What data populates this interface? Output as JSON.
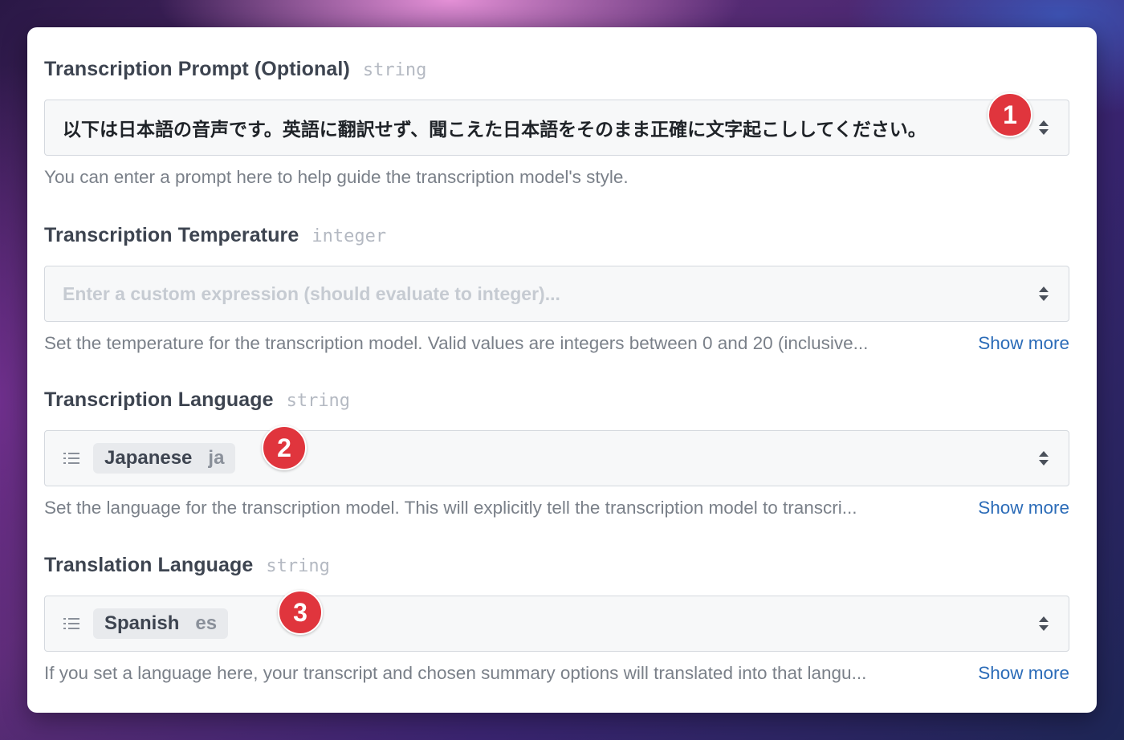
{
  "fields": [
    {
      "label": "Transcription Prompt (Optional)",
      "type": "string",
      "value": "以下は日本語の音声です。英語に翻訳せず、聞こえた日本語をそのまま正確に文字起こししてください。",
      "help": "You can enter a prompt here to help guide the transcription model's style.",
      "badge": "1"
    },
    {
      "label": "Transcription Temperature",
      "type": "integer",
      "placeholder": "Enter a custom expression (should evaluate to integer)...",
      "help": "Set the temperature for the transcription model. Valid values are integers between 0 and 20 (inclusive...",
      "show_more": "Show more"
    },
    {
      "label": "Transcription Language",
      "type": "string",
      "selected": {
        "name": "Japanese",
        "code": "ja"
      },
      "help": "Set the language for the transcription model. This will explicitly tell the transcription model to transcri...",
      "show_more": "Show more",
      "badge": "2"
    },
    {
      "label": "Translation Language",
      "type": "string",
      "selected": {
        "name": "Spanish",
        "code": "es"
      },
      "help": "If you set a language here, your transcript and chosen summary options will translated into that langu...",
      "show_more": "Show more",
      "badge": "3"
    }
  ],
  "icons": {
    "spinner": "up-down-chevron-icon",
    "list": "list-icon"
  },
  "colors": {
    "badge": "#e0353d",
    "link": "#2c6cb8",
    "label": "#3d4450",
    "help": "#7a8089"
  }
}
